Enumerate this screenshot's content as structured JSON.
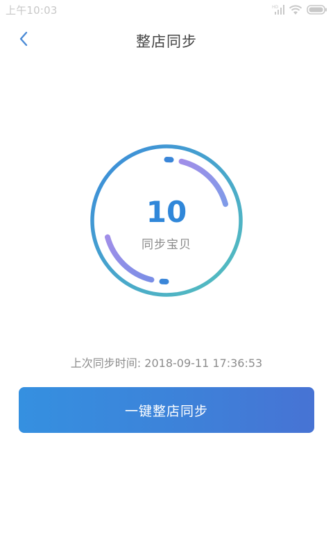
{
  "status_bar": {
    "time": "上午10:03",
    "icons": [
      "hd-signal-icon",
      "wifi-icon",
      "battery-icon"
    ],
    "network_badge": "HD"
  },
  "header": {
    "title": "整店同步",
    "back_icon": "chevron-left-icon"
  },
  "sync_ring": {
    "count": "10",
    "label": "同步宝贝"
  },
  "last_sync": {
    "label": "上次同步时间:",
    "datetime": "2018-09-11 17:36:53"
  },
  "sync_button": {
    "label": "一键整店同步"
  },
  "colors": {
    "accent": "#3087d9",
    "ring_start": "#3a8fdb",
    "ring_end": "#52bbc0",
    "arc": "#9b8eea",
    "button_start": "#3590e0",
    "button_end": "#4773d4"
  }
}
